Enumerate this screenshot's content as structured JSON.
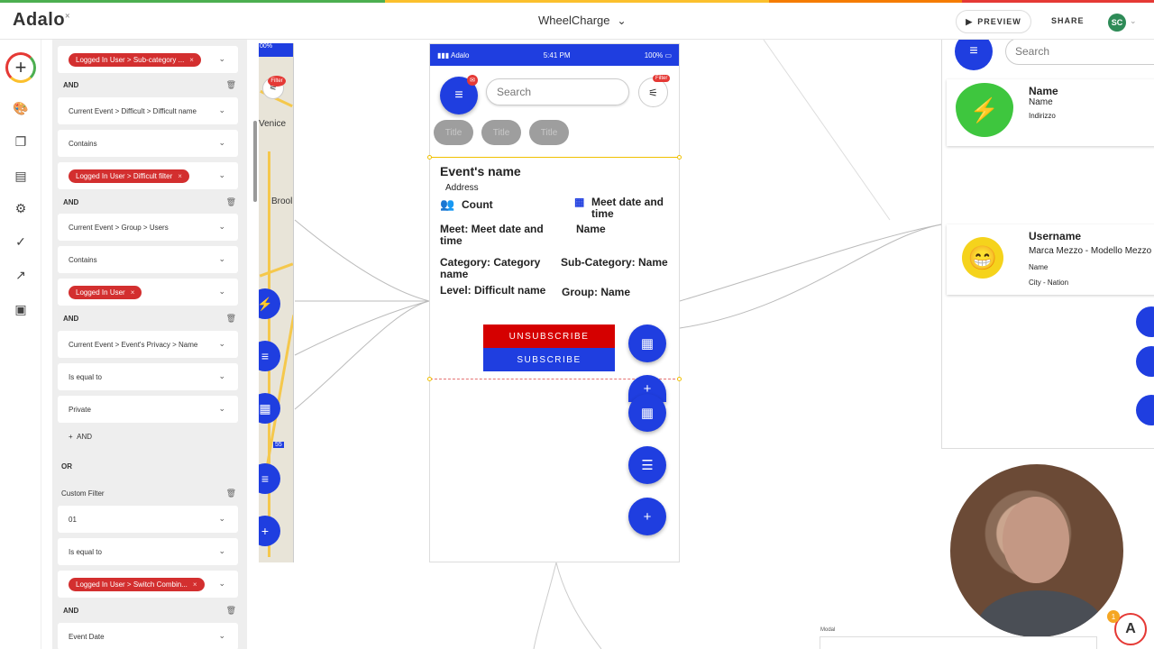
{
  "brand": {
    "logo_text": "Adalo",
    "stripe_colors": [
      "#e53935",
      "#4caf50",
      "#fbc02d",
      "#f57c00"
    ],
    "accent": "#1f3ee0",
    "danger": "#d50000"
  },
  "header": {
    "app_name": "WheelCharge",
    "preview_label": "PREVIEW",
    "share_label": "SHARE",
    "user_initials": "SC"
  },
  "rail": {
    "icons": [
      "add-icon",
      "palette-icon",
      "screens-icon",
      "database-icon",
      "settings-icon",
      "publish-icon",
      "analytics-icon",
      "docs-icon"
    ]
  },
  "filter_panel": {
    "rows": [
      {
        "type": "chip",
        "text": "Logged In User > Sub-category ..."
      },
      {
        "type": "and",
        "text": "AND"
      },
      {
        "type": "field",
        "text": "Current Event > Difficult > Difficult name"
      },
      {
        "type": "field",
        "text": "Contains"
      },
      {
        "type": "chip",
        "text": "Logged In User > Difficult filter"
      },
      {
        "type": "and",
        "text": "AND"
      },
      {
        "type": "field",
        "text": "Current Event > Group > Users"
      },
      {
        "type": "field",
        "text": "Contains"
      },
      {
        "type": "chip",
        "text": "Logged In User"
      },
      {
        "type": "and",
        "text": "AND"
      },
      {
        "type": "field",
        "text": "Current Event > Event's Privacy > Name"
      },
      {
        "type": "field",
        "text": "Is equal to"
      },
      {
        "type": "field",
        "text": "Private"
      },
      {
        "type": "add",
        "text": "AND"
      },
      {
        "type": "or",
        "text": "OR"
      },
      {
        "type": "header",
        "text": "Custom Filter"
      },
      {
        "type": "field",
        "text": "01"
      },
      {
        "type": "field",
        "text": "Is equal to"
      },
      {
        "type": "chip",
        "text": "Logged In User > Switch Combin..."
      },
      {
        "type": "and",
        "text": "AND"
      },
      {
        "type": "field",
        "text": "Event Date"
      }
    ]
  },
  "map_screen": {
    "labels": [
      "Venice",
      "Brool",
      "55"
    ],
    "filter_tag": "Filter",
    "battery": "00%"
  },
  "phone": {
    "status": {
      "carrier": "Adalo",
      "time": "5:41 PM",
      "battery": "100%"
    },
    "search_placeholder": "Search",
    "filter_tag": "Filter",
    "menu_badge": "✉",
    "pills": [
      "Title",
      "Title",
      "Title"
    ],
    "card": {
      "event_name": "Event's name",
      "address": "Address",
      "count": "Count",
      "meet_date_right": "Meet date and time",
      "meet_line": "Meet: Meet date and time",
      "name_right": "Name",
      "category": "Category: Category name",
      "subcategory": "Sub-Category: Name",
      "level": "Level: Difficult name",
      "group": "Group: Name",
      "unsubscribe": "UNSUBSCRIBE",
      "subscribe": "SUBSCRIBE"
    }
  },
  "right_screen": {
    "search_placeholder": "Search",
    "card1": {
      "title": "Name",
      "subtitle": "Name",
      "detail": "Indirizzo"
    },
    "card2": {
      "title": "Username",
      "subtitle": "Marca Mezzo - Modello Mezzo",
      "detail1": "Name",
      "detail2": "City - Nation"
    }
  },
  "modal_label": "Modal",
  "help_badge": "1"
}
